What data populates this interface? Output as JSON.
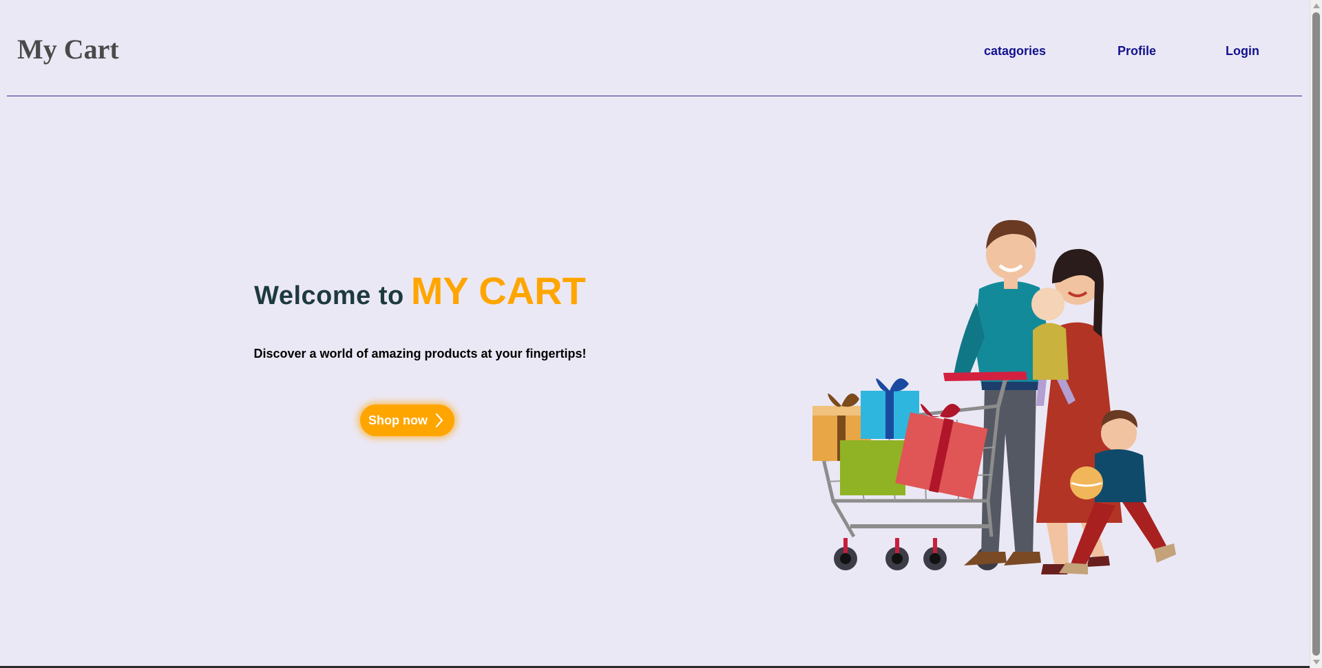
{
  "header": {
    "logo": "My Cart",
    "nav": [
      {
        "label": "catagories"
      },
      {
        "label": "Profile"
      },
      {
        "label": "Login"
      }
    ]
  },
  "hero": {
    "welcome": "Welcome to",
    "brand": "MY CART",
    "tagline": "Discover a world of amazing products at your fingertips!",
    "cta_label": "Shop now",
    "cta_icon": "chevron-right-icon",
    "illustration": "family-shopping-cart-illustration"
  },
  "colors": {
    "background": "#ebe8f5",
    "nav_link": "#12128c",
    "accent": "#ffa500",
    "welcome_text": "#1d3a3f",
    "logo": "#4a4a4a"
  }
}
